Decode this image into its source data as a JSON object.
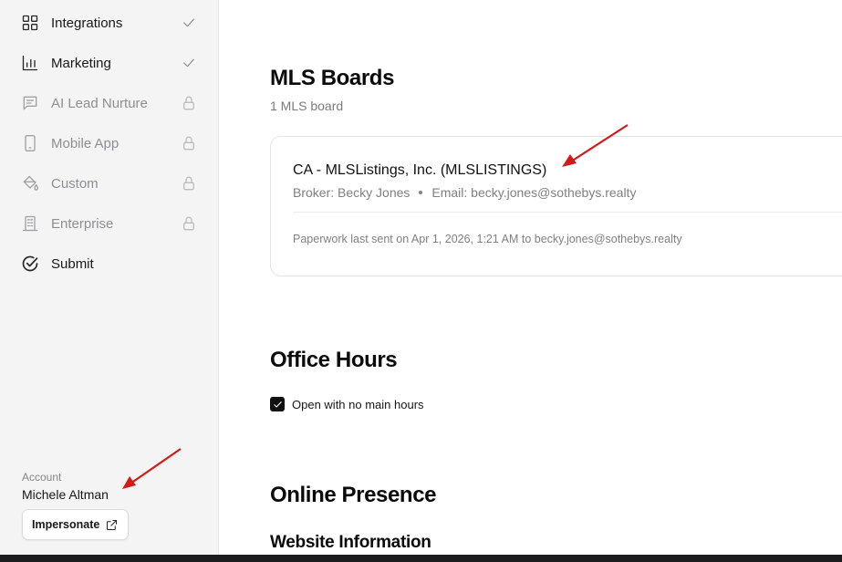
{
  "sidebar": {
    "items": [
      {
        "label": "Integrations",
        "icon": "grid-icon",
        "status": "check-icon"
      },
      {
        "label": "Marketing",
        "icon": "bar-chart-icon",
        "status": "check-icon"
      },
      {
        "label": "AI Lead Nurture",
        "icon": "chat-icon",
        "status": "lock-icon"
      },
      {
        "label": "Mobile App",
        "icon": "phone-icon",
        "status": "lock-icon"
      },
      {
        "label": "Custom",
        "icon": "paint-bucket-icon",
        "status": "lock-icon"
      },
      {
        "label": "Enterprise",
        "icon": "building-icon",
        "status": "lock-icon"
      },
      {
        "label": "Submit",
        "icon": "check-circle-icon",
        "status": ""
      }
    ],
    "account": {
      "caption": "Account",
      "name": "Michele Altman",
      "impersonate_label": "Impersonate",
      "impersonate_icon": "external-link-icon"
    }
  },
  "main": {
    "mls": {
      "title": "MLS Boards",
      "count": "1 MLS board",
      "board": {
        "name": "CA - MLSListings, Inc. (MLSLISTINGS)",
        "broker": "Broker: Becky Jones",
        "email": "Email: becky.jones@sothebys.realty",
        "paperwork": "Paperwork last sent on Apr 1, 2026, 1:21 AM to becky.jones@sothebys.realty"
      }
    },
    "office_hours": {
      "title": "Office Hours",
      "checkbox_label": "Open with no main hours",
      "checked": true
    },
    "online_presence": {
      "title": "Online Presence",
      "subtitle": "Website Information"
    }
  },
  "colors": {
    "sidebar_bg": "#f4f4f5",
    "annotation_arrow": "#d11a1a",
    "text_primary": "#111111",
    "text_muted": "#808086"
  }
}
